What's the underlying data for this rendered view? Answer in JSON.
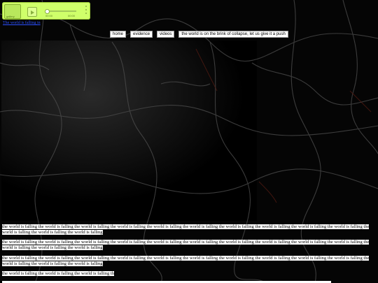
{
  "player": {
    "cover_label": "gallery",
    "track_title": "",
    "time_current": "00:00",
    "time_total": "00:00",
    "progress": 0
  },
  "top_link": "The world is falling in",
  "nav": {
    "items": [
      "home",
      "evidence",
      "videos",
      "the world is on the brink of collapse, let us give it a push"
    ]
  },
  "paragraphs": [
    "the world is falling the world is falling the world is falling the world is falling the world is falling the world is falling the world is falling the world is falling the world is falling the world is falling the world is falling the world is falling the world is falling",
    "the world is falling the world is falling the world is falling the world is falling the world is falling the world is falling the world is falling the world is falling the world is falling the world is falling the world is falling the world is falling the world is falling",
    "the world is falling the world is falling the world is falling the world is falling the world is falling the world is falling the world is falling the world is falling the world is falling the world is falling the world is falling the world is falling the world is falling",
    "the world is falling the world is falling the world is falling th"
  ],
  "colors": {
    "player_bg": "#cfff6a",
    "background": "#000000",
    "link": "#2a4fff"
  }
}
